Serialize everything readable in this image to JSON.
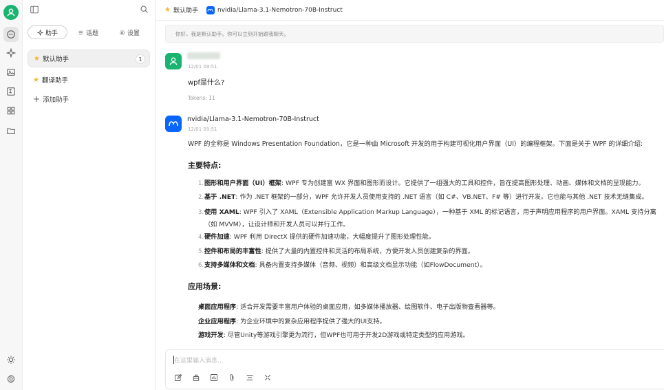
{
  "rail": {
    "icons": [
      "user-avatar-icon",
      "chat-icon",
      "sparkle-icon",
      "image-icon",
      "translate-icon",
      "apps-icon",
      "folder-icon",
      "theme-icon",
      "settings-icon"
    ]
  },
  "panel": {
    "tabs": [
      {
        "label": "助手",
        "icon": "sparkle-icon"
      },
      {
        "label": "话题",
        "icon": "list-icon"
      },
      {
        "label": "设置",
        "icon": "gear-icon"
      }
    ],
    "assistants": [
      {
        "label": "默认助手",
        "badge": "1"
      },
      {
        "label": "翻译助手"
      }
    ],
    "add_label": "添加助手"
  },
  "topbar": {
    "assistant": "默认助手",
    "model": "nvidia/Llama-3.1-Nemotron-70B-Instruct"
  },
  "system_prompt": "你好，我是默认助手。你可以立刻开始跟我聊天。",
  "messages": {
    "user": {
      "time": "12/01 09:51",
      "text": "wpf是什么?",
      "tokens": "Tokens: 11"
    },
    "bot": {
      "name": "nvidia/Llama-3.1-Nemotron-70B-Instruct",
      "time": "12/01 09:51",
      "intro": "WPF 的全称是 Windows Presentation Foundation，它是一种由 Microsoft 开发的用于构建可视化用户界面（UI）的编程框架。下面是关于 WPF 的详细介绍:",
      "h_features": "主要特点:",
      "features": [
        {
          "num": "1.",
          "title": "图形和用户界面（UI）框架",
          "text": ": WPF 专为创建富 WX 界面和图形而设计。它提供了一组强大的工具和控件，旨在提高图形处理、动画、媒体和文档的呈现能力。"
        },
        {
          "num": "2.",
          "title": "基于 .NET",
          "text": ": 作为 .NET 框架的一部分，WPF 允许开发人员使用支持的 .NET 语言（如 C#、VB.NET、F# 等）进行开发。它也能与其他 .NET 技术无缝集成。"
        },
        {
          "num": "3.",
          "title": "使用 XAML",
          "text": ": WPF 引入了 XAML（Extensible Application Markup Language），一种基于 XML 的标记语言，用于声明应用程序的用户界面。XAML 支持分离",
          "cont": "（如 MVVM），让设计师和开发人员可以并行工作。"
        },
        {
          "num": "4.",
          "title": "硬件加速",
          "text": ": WPF 利用 DirectX 提供的硬件加速功能，大幅度提升了图形处理性能。"
        },
        {
          "num": "5.",
          "title": "控件和布局的丰富性",
          "text": ": 提供了大量的内置控件和灵活的布局系统，方便开发人员创建复杂的界面。"
        },
        {
          "num": "6.",
          "title": "支持多媒体和文档",
          "text": ": 具备内置支持多媒体（音频、视频）和高级文档显示功能（如FlowDocument）。"
        }
      ],
      "h_scenarios": "应用场景:",
      "scenarios": [
        {
          "title": "桌面应用程序",
          "text": ": 适合开发需要丰富用户体验的桌面应用，如多媒体播放器、绘图软件、电子出版物查看器等。"
        },
        {
          "title": "企业应用程序",
          "text": ": 为企业环境中的复杂应用程序提供了强大的UI支持。"
        },
        {
          "title": "游戏开发",
          "text": ": 尽管Unity等游戏引擎更为流行，但WPF也可用于开发2D游戏或特定类型的应用游戏。"
        }
      ]
    }
  },
  "input": {
    "placeholder": "在这里输入消息...",
    "tools": [
      "new-topic-icon",
      "assistant-icon",
      "web-search-icon",
      "attachment-icon",
      "clear-icon",
      "expand-icon"
    ]
  },
  "colors": {
    "accent": "#19b470",
    "meta": "#0866ff",
    "star": "#f2b632"
  }
}
